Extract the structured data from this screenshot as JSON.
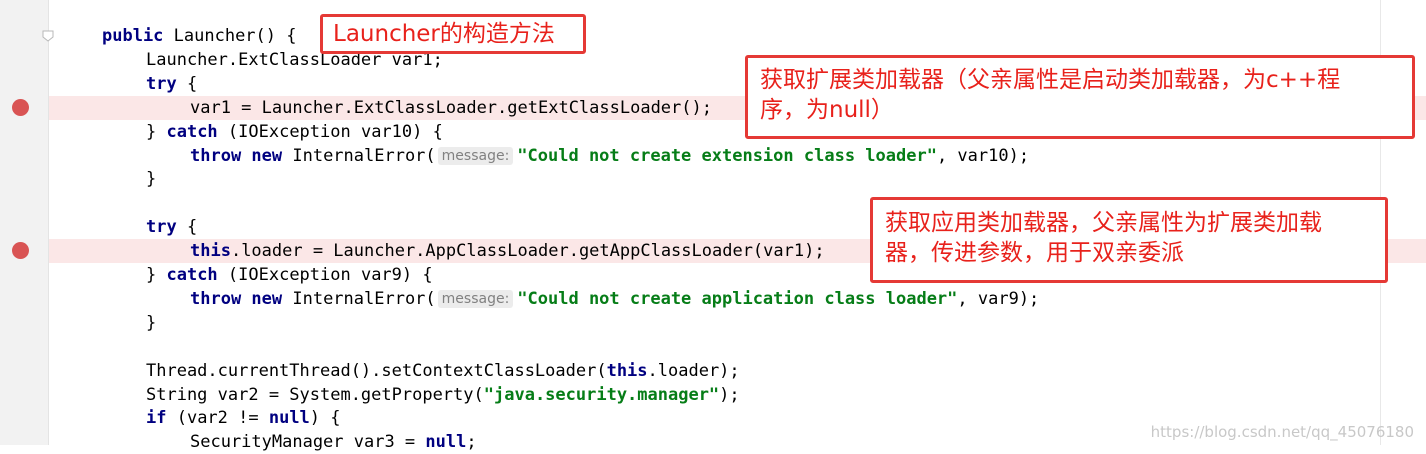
{
  "editor": {
    "lines": [
      {
        "indent": 0,
        "breakpoint": false,
        "tokens": [
          {
            "t": "kw",
            "v": "public"
          },
          {
            "t": "p",
            "v": " Launcher() {"
          }
        ]
      },
      {
        "indent": 1,
        "breakpoint": false,
        "tokens": [
          {
            "t": "p",
            "v": "Launcher.ExtClassLoader var1;"
          }
        ]
      },
      {
        "indent": 1,
        "breakpoint": false,
        "tokens": [
          {
            "t": "kw",
            "v": "try"
          },
          {
            "t": "p",
            "v": " {"
          }
        ]
      },
      {
        "indent": 2,
        "breakpoint": true,
        "tokens": [
          {
            "t": "p",
            "v": "var1 = Launcher.ExtClassLoader.getExtClassLoader();"
          }
        ]
      },
      {
        "indent": 1,
        "breakpoint": false,
        "tokens": [
          {
            "t": "p",
            "v": "} "
          },
          {
            "t": "kw",
            "v": "catch"
          },
          {
            "t": "p",
            "v": " (IOException var10) {"
          }
        ]
      },
      {
        "indent": 2,
        "breakpoint": false,
        "tokens": [
          {
            "t": "kw",
            "v": "throw new"
          },
          {
            "t": "p",
            "v": " InternalError("
          },
          {
            "t": "hint",
            "v": "message:"
          },
          {
            "t": "str",
            "v": "\"Could not create extension class loader\""
          },
          {
            "t": "p",
            "v": ", var10);"
          }
        ]
      },
      {
        "indent": 1,
        "breakpoint": false,
        "tokens": [
          {
            "t": "p",
            "v": "}"
          }
        ]
      },
      {
        "indent": 0,
        "breakpoint": false,
        "tokens": []
      },
      {
        "indent": 1,
        "breakpoint": false,
        "tokens": [
          {
            "t": "kw",
            "v": "try"
          },
          {
            "t": "p",
            "v": " {"
          }
        ]
      },
      {
        "indent": 2,
        "breakpoint": true,
        "tokens": [
          {
            "t": "kw",
            "v": "this"
          },
          {
            "t": "p",
            "v": ".loader = Launcher.AppClassLoader.getAppClassLoader(var1);"
          }
        ]
      },
      {
        "indent": 1,
        "breakpoint": false,
        "tokens": [
          {
            "t": "p",
            "v": "} "
          },
          {
            "t": "kw",
            "v": "catch"
          },
          {
            "t": "p",
            "v": " (IOException var9) {"
          }
        ]
      },
      {
        "indent": 2,
        "breakpoint": false,
        "tokens": [
          {
            "t": "kw",
            "v": "throw new"
          },
          {
            "t": "p",
            "v": " InternalError("
          },
          {
            "t": "hint",
            "v": "message:"
          },
          {
            "t": "str",
            "v": "\"Could not create application class loader\""
          },
          {
            "t": "p",
            "v": ", var9);"
          }
        ]
      },
      {
        "indent": 1,
        "breakpoint": false,
        "tokens": [
          {
            "t": "p",
            "v": "}"
          }
        ]
      },
      {
        "indent": 0,
        "breakpoint": false,
        "tokens": []
      },
      {
        "indent": 1,
        "breakpoint": false,
        "tokens": [
          {
            "t": "p",
            "v": "Thread.currentThread().setContextClassLoader("
          },
          {
            "t": "kw",
            "v": "this"
          },
          {
            "t": "p",
            "v": ".loader);"
          }
        ]
      },
      {
        "indent": 1,
        "breakpoint": false,
        "tokens": [
          {
            "t": "p",
            "v": "String var2 = System.getProperty("
          },
          {
            "t": "str",
            "v": "\"java.security.manager\""
          },
          {
            "t": "p",
            "v": ");"
          }
        ]
      },
      {
        "indent": 1,
        "breakpoint": false,
        "tokens": [
          {
            "t": "kw",
            "v": "if"
          },
          {
            "t": "p",
            "v": " (var2 != "
          },
          {
            "t": "kw",
            "v": "null"
          },
          {
            "t": "p",
            "v": ") {"
          }
        ]
      },
      {
        "indent": 2,
        "breakpoint": false,
        "tokens": [
          {
            "t": "p",
            "v": "SecurityManager var3 = "
          },
          {
            "t": "kw",
            "v": "null"
          },
          {
            "t": "p",
            "v": ";"
          }
        ]
      }
    ]
  },
  "annotations": {
    "constructor": "Launcher的构造方法",
    "ext_loader_line1": "获取扩展类加载器（父亲属性是启动类加载器，为c++程",
    "ext_loader_line2": "序，为null）",
    "app_loader_line1": "获取应用类加载器，父亲属性为扩展类加载",
    "app_loader_line2": "器，传进参数，用于双亲委派"
  },
  "watermark": "https://blog.csdn.net/qq_45076180",
  "colors": {
    "keyword": "#000080",
    "string": "#067d17",
    "annotation_red": "#e53935",
    "breakpoint": "#d95454",
    "breakpoint_line": "#fbe7e7"
  },
  "icons": {
    "breakpoint": "breakpoint-icon",
    "fold": "fold-marker-icon"
  }
}
